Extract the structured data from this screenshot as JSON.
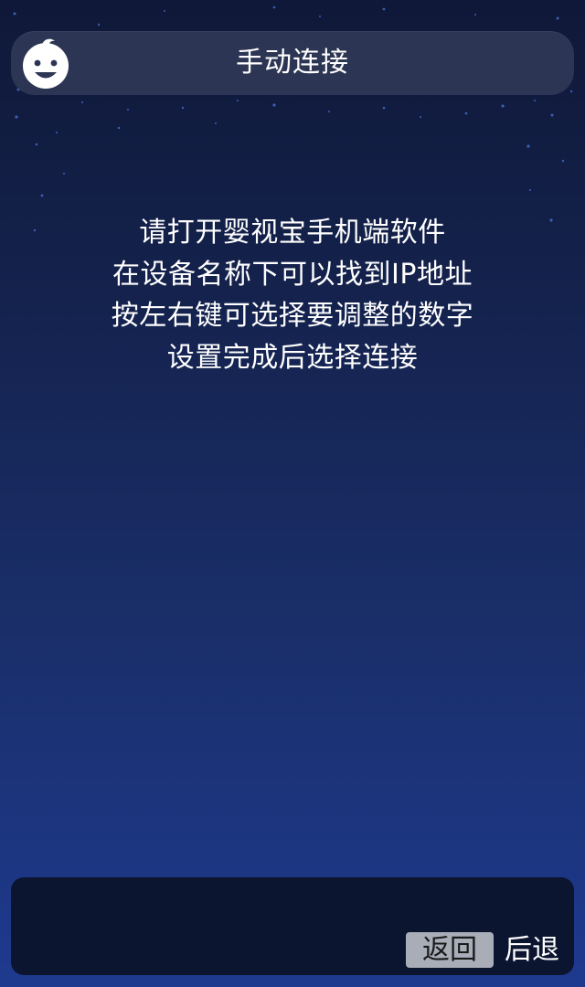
{
  "header": {
    "title": "手动连接",
    "icon": "baby-face-icon"
  },
  "instructions": [
    "请打开婴视宝手机端软件",
    "在设备名称下可以找到IP地址",
    "按左右键可选择要调整的数字",
    "设置完成后选择连接"
  ],
  "footer": {
    "back_button_label": "返回",
    "back_hint": "后退"
  },
  "colors": {
    "background_top": "#0f1838",
    "background_bottom": "#1e3a8f",
    "header_bar": "#2c3553",
    "footer_bar": "#0b1530",
    "button": "#a8adb8"
  }
}
